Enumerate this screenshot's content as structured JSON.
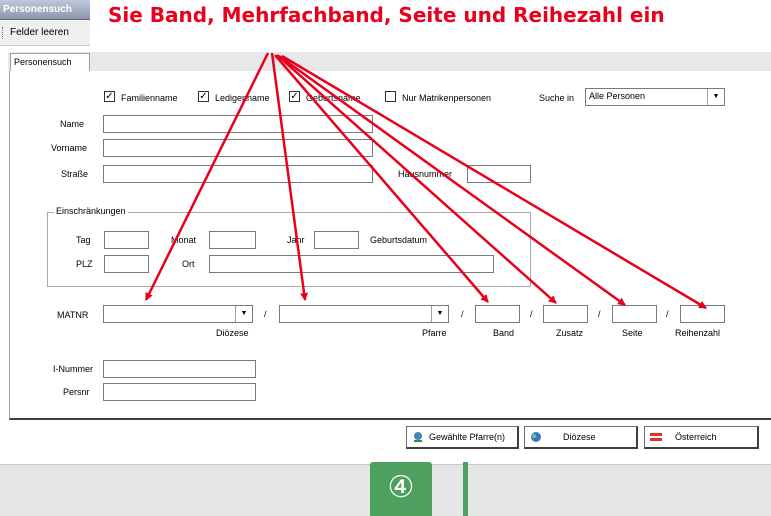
{
  "window": {
    "title": "Personensuch"
  },
  "menu": {
    "clear_label": "Felder leeren"
  },
  "instruction": {
    "text": "Sie Band, Mehrfachband, Seite und Reihezahl ein"
  },
  "tab": {
    "label": "Personensuch"
  },
  "options": {
    "familienname": {
      "label": "Familienname",
      "checked": true
    },
    "ledigenname": {
      "label": "Ledigenname",
      "checked": true
    },
    "geburtsname": {
      "label": "Geburtsname",
      "checked": true
    },
    "nur_matrikenpersonen": {
      "label": "Nur Matrikenpersonen",
      "checked": false
    },
    "suche_in": {
      "label": "Suche in",
      "value": "Alle Personen"
    }
  },
  "fields": {
    "name": "Name",
    "vorname": "Vorname",
    "strasse": "Straße",
    "hausnummer": "Hausnummer"
  },
  "restrictions": {
    "title": "Einschränkungen",
    "tag": "Tag",
    "monat": "Monat",
    "jahr": "Jahr",
    "geburtsdatum": "Geburtsdatum",
    "plz": "PLZ",
    "ort": "Ort"
  },
  "matnr": {
    "label": "MATNR",
    "dioezese": "Diözese",
    "pfarre": "Pfarre",
    "band": "Band",
    "zusatz": "Zusatz",
    "seite": "Seite",
    "reihenzahl": "Reihenzahl",
    "separator": "/"
  },
  "extra": {
    "inummer": "I-Nummer",
    "persnr": "Persnr"
  },
  "buttons": {
    "selected_parishes": "Gewählte Pfarre(n)",
    "diocese": "Diözese",
    "austria": "Österreich"
  },
  "step_badge": "④",
  "colors": {
    "annotation": "#e8001c",
    "badge": "#4ea05e"
  }
}
